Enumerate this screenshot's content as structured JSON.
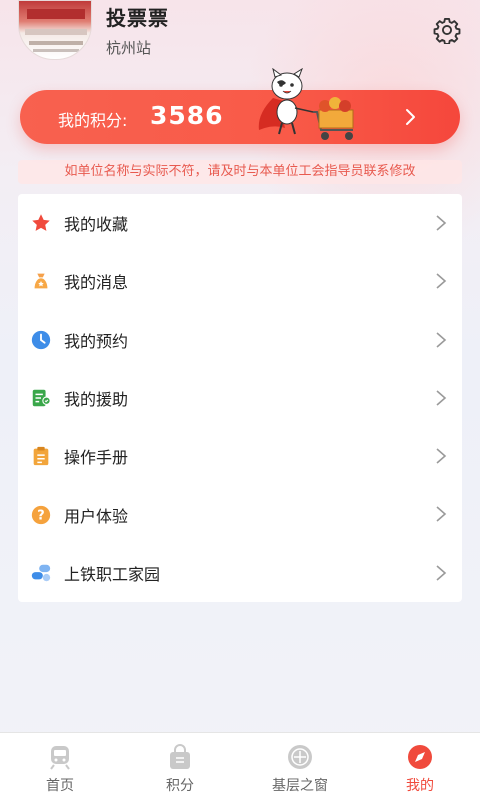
{
  "user": {
    "name": "投票票",
    "station": "杭州站"
  },
  "points": {
    "label": "我的积分:",
    "value": "3586"
  },
  "notice": "如单位名称与实际不符，请及时与本单位工会指导员联系修改",
  "menu": [
    {
      "label": "我的收藏",
      "icon": "star-icon"
    },
    {
      "label": "我的消息",
      "icon": "money-bag-icon"
    },
    {
      "label": "我的预约",
      "icon": "clock-icon"
    },
    {
      "label": "我的援助",
      "icon": "assistance-icon"
    },
    {
      "label": "操作手册",
      "icon": "clipboard-icon"
    },
    {
      "label": "用户体验",
      "icon": "question-icon"
    },
    {
      "label": "上铁职工家园",
      "icon": "pills-icon"
    }
  ],
  "nav": [
    {
      "label": "首页",
      "icon": "train-icon",
      "active": false
    },
    {
      "label": "积分",
      "icon": "bag-icon",
      "active": false
    },
    {
      "label": "基层之窗",
      "icon": "emblem-icon",
      "active": false
    },
    {
      "label": "我的",
      "icon": "compass-icon",
      "active": true
    }
  ],
  "colors": {
    "accent": "#f95a48",
    "notice_text": "#e85a4f",
    "active_nav": "#f04a3c"
  }
}
